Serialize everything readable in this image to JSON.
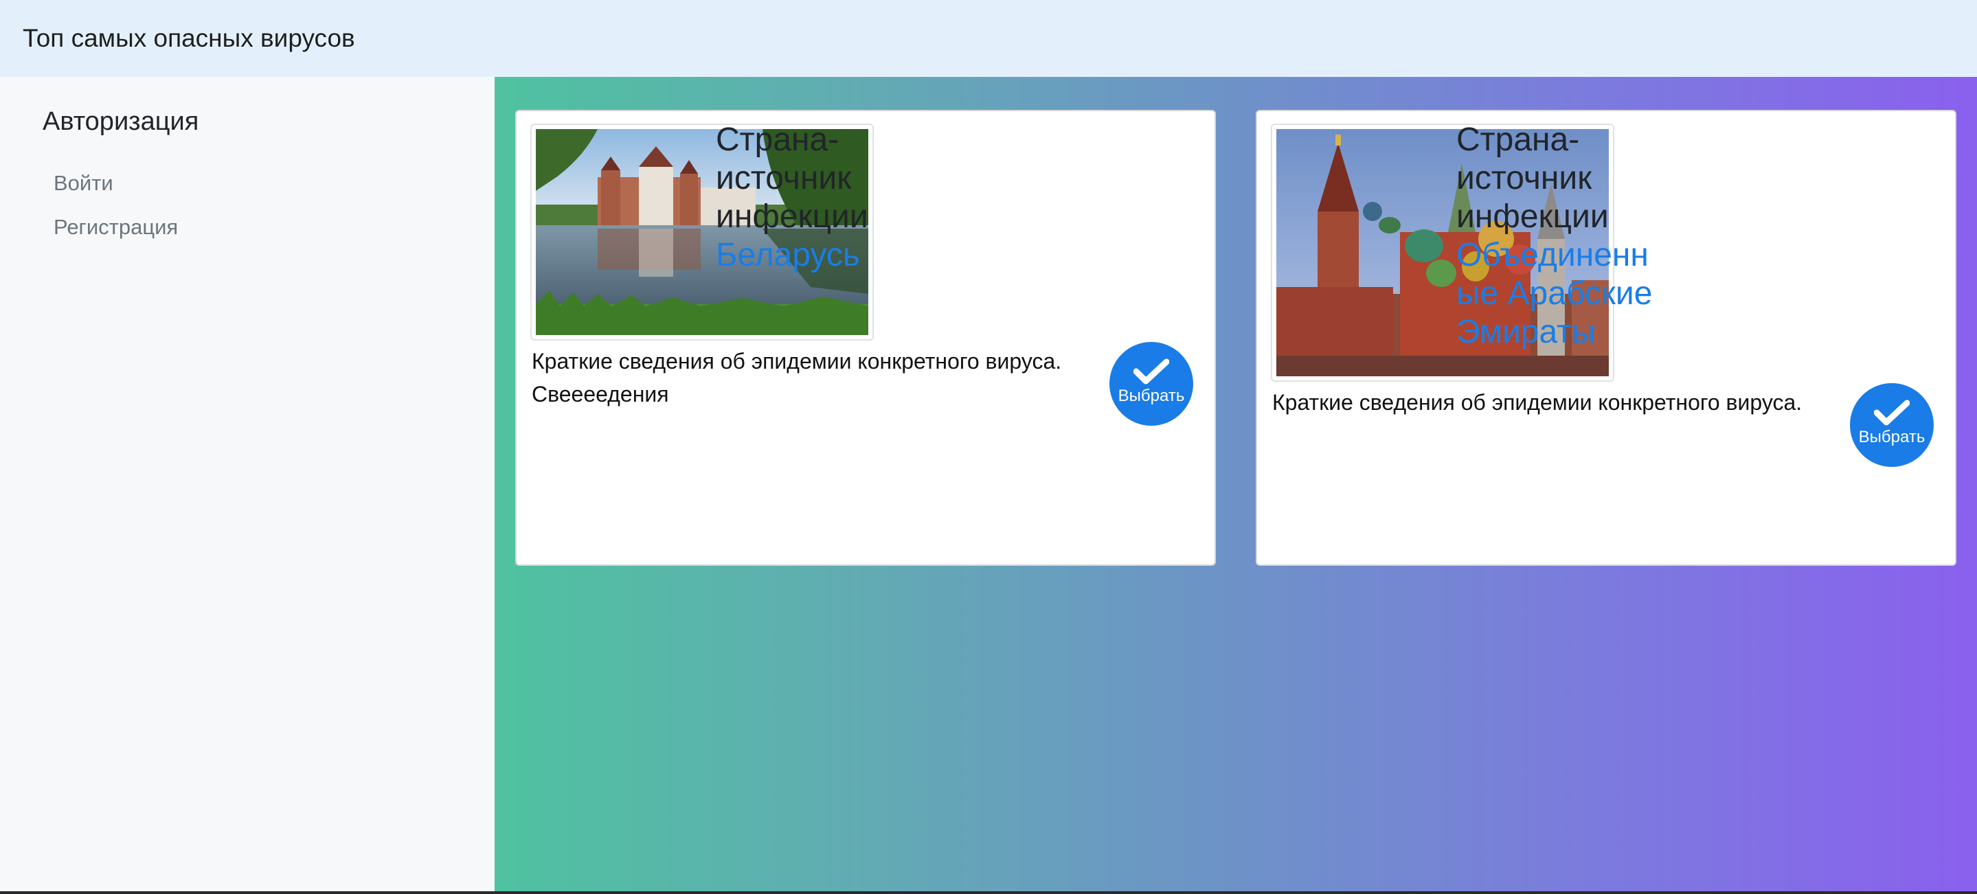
{
  "header": {
    "title": "Топ самых опасных вирусов"
  },
  "sidebar": {
    "heading": "Авторизация",
    "items": [
      {
        "label": "Войти"
      },
      {
        "label": "Регистрация"
      }
    ]
  },
  "cards": [
    {
      "title": "Страна-источник инфекции",
      "title_line1": "Страна-",
      "title_line2": "источник",
      "title_line3": "инфекции",
      "country": "Беларусь",
      "country_line1": "Беларусь",
      "text_line1": "Краткие сведения об эпидемии конкретного вируса.",
      "text_line2": "Свеееедения",
      "button_label": "Выбрать"
    },
    {
      "title": "Страна-источник инфекции",
      "title_line1": "Страна-",
      "title_line2": "источник",
      "title_line3": "инфекции",
      "country": "Объединенные Арабские Эмираты",
      "country_line1": "Объединенн",
      "country_line2": "ые Арабские",
      "country_line3": "Эмираты",
      "text_line1": "Краткие сведения об эпидемии конкретного вируса.",
      "button_label": "Выбрать"
    }
  ],
  "colors": {
    "accent": "#1a7de6",
    "topbar_bg": "#e3f0fc",
    "sidebar_bg": "#f7f8fa",
    "gradient_start": "#4fc2a0",
    "gradient_end": "#8a60ee"
  }
}
